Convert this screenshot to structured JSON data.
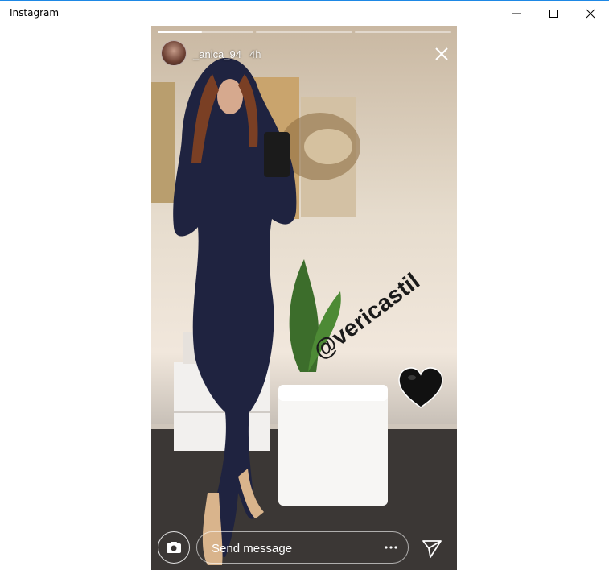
{
  "window": {
    "title": "Instagram",
    "accent_color": "#1e88e5"
  },
  "story": {
    "username": "_anica_94",
    "time_ago": "4h",
    "progress": {
      "segments": 3,
      "current_segment": 1,
      "current_fill": 0.46
    },
    "mention_sticker": "@vericastil",
    "sticker_icon": "black-heart-icon",
    "reply": {
      "placeholder": "Send message",
      "camera_icon": "camera-icon",
      "more_icon": "more-horizontal-icon",
      "send_icon": "send-icon"
    }
  }
}
